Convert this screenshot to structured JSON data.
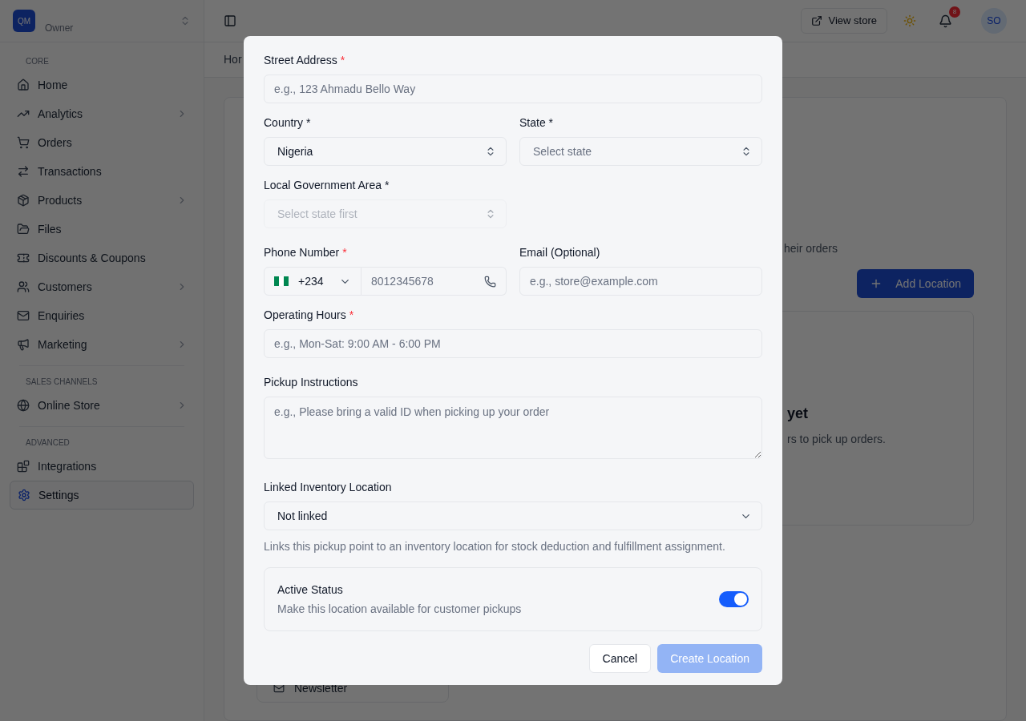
{
  "sidebar": {
    "store": {
      "logo": "QM",
      "role": "Owner"
    },
    "sections": [
      {
        "title": "CORE",
        "items": [
          {
            "label": "Home",
            "expandable": false,
            "selected": false
          },
          {
            "label": "Analytics",
            "expandable": true,
            "selected": false
          },
          {
            "label": "Orders",
            "expandable": false,
            "selected": false
          },
          {
            "label": "Transactions",
            "expandable": false,
            "selected": false
          },
          {
            "label": "Products",
            "expandable": true,
            "selected": false
          },
          {
            "label": "Files",
            "expandable": false,
            "selected": false
          },
          {
            "label": "Discounts & Coupons",
            "expandable": false,
            "selected": false
          },
          {
            "label": "Customers",
            "expandable": true,
            "selected": false
          },
          {
            "label": "Enquiries",
            "expandable": false,
            "selected": false
          },
          {
            "label": "Marketing",
            "expandable": true,
            "selected": false
          }
        ]
      },
      {
        "title": "SALES CHANNELS",
        "items": [
          {
            "label": "Online Store",
            "expandable": true,
            "selected": false
          }
        ]
      },
      {
        "title": "ADVANCED",
        "items": [
          {
            "label": "Integrations",
            "expandable": false,
            "selected": false
          },
          {
            "label": "Settings",
            "expandable": false,
            "selected": true
          }
        ]
      }
    ]
  },
  "header": {
    "view_store": "View store",
    "notifications": "8",
    "avatar": "SO"
  },
  "breadcrumb": "Hor",
  "background": {
    "subtitle": "heir orders",
    "add_button": "Add Location",
    "empty_title": "yet",
    "empty_text": "rs to pick up orders.",
    "newsletter": "Newsletter"
  },
  "dialog": {
    "street": {
      "label": "Street Address",
      "required_mark": "*",
      "placeholder": "e.g., 123 Ahmadu Bello Way"
    },
    "country": {
      "label": "Country *",
      "value": "Nigeria"
    },
    "state": {
      "label": "State *",
      "placeholder": "Select state"
    },
    "lga": {
      "label": "Local Government Area *",
      "placeholder": "Select state first",
      "disabled": true
    },
    "phone": {
      "label": "Phone Number",
      "required_mark": "*",
      "code": "+234",
      "placeholder": "8012345678"
    },
    "email": {
      "label": "Email (Optional)",
      "placeholder": "e.g., store@example.com"
    },
    "hours": {
      "label": "Operating Hours",
      "required_mark": "*",
      "placeholder": "e.g., Mon-Sat: 9:00 AM - 6:00 PM"
    },
    "instructions": {
      "label": "Pickup Instructions",
      "placeholder": "e.g., Please bring a valid ID when picking up your order"
    },
    "inventory": {
      "label": "Linked Inventory Location",
      "value": "Not linked",
      "help": "Links this pickup point to an inventory location for stock deduction and fulfillment assignment."
    },
    "active": {
      "title": "Active Status",
      "description": "Make this location available for customer pickups",
      "on": true
    },
    "cancel": "Cancel",
    "create": {
      "label": "Create Location",
      "disabled": true
    }
  }
}
